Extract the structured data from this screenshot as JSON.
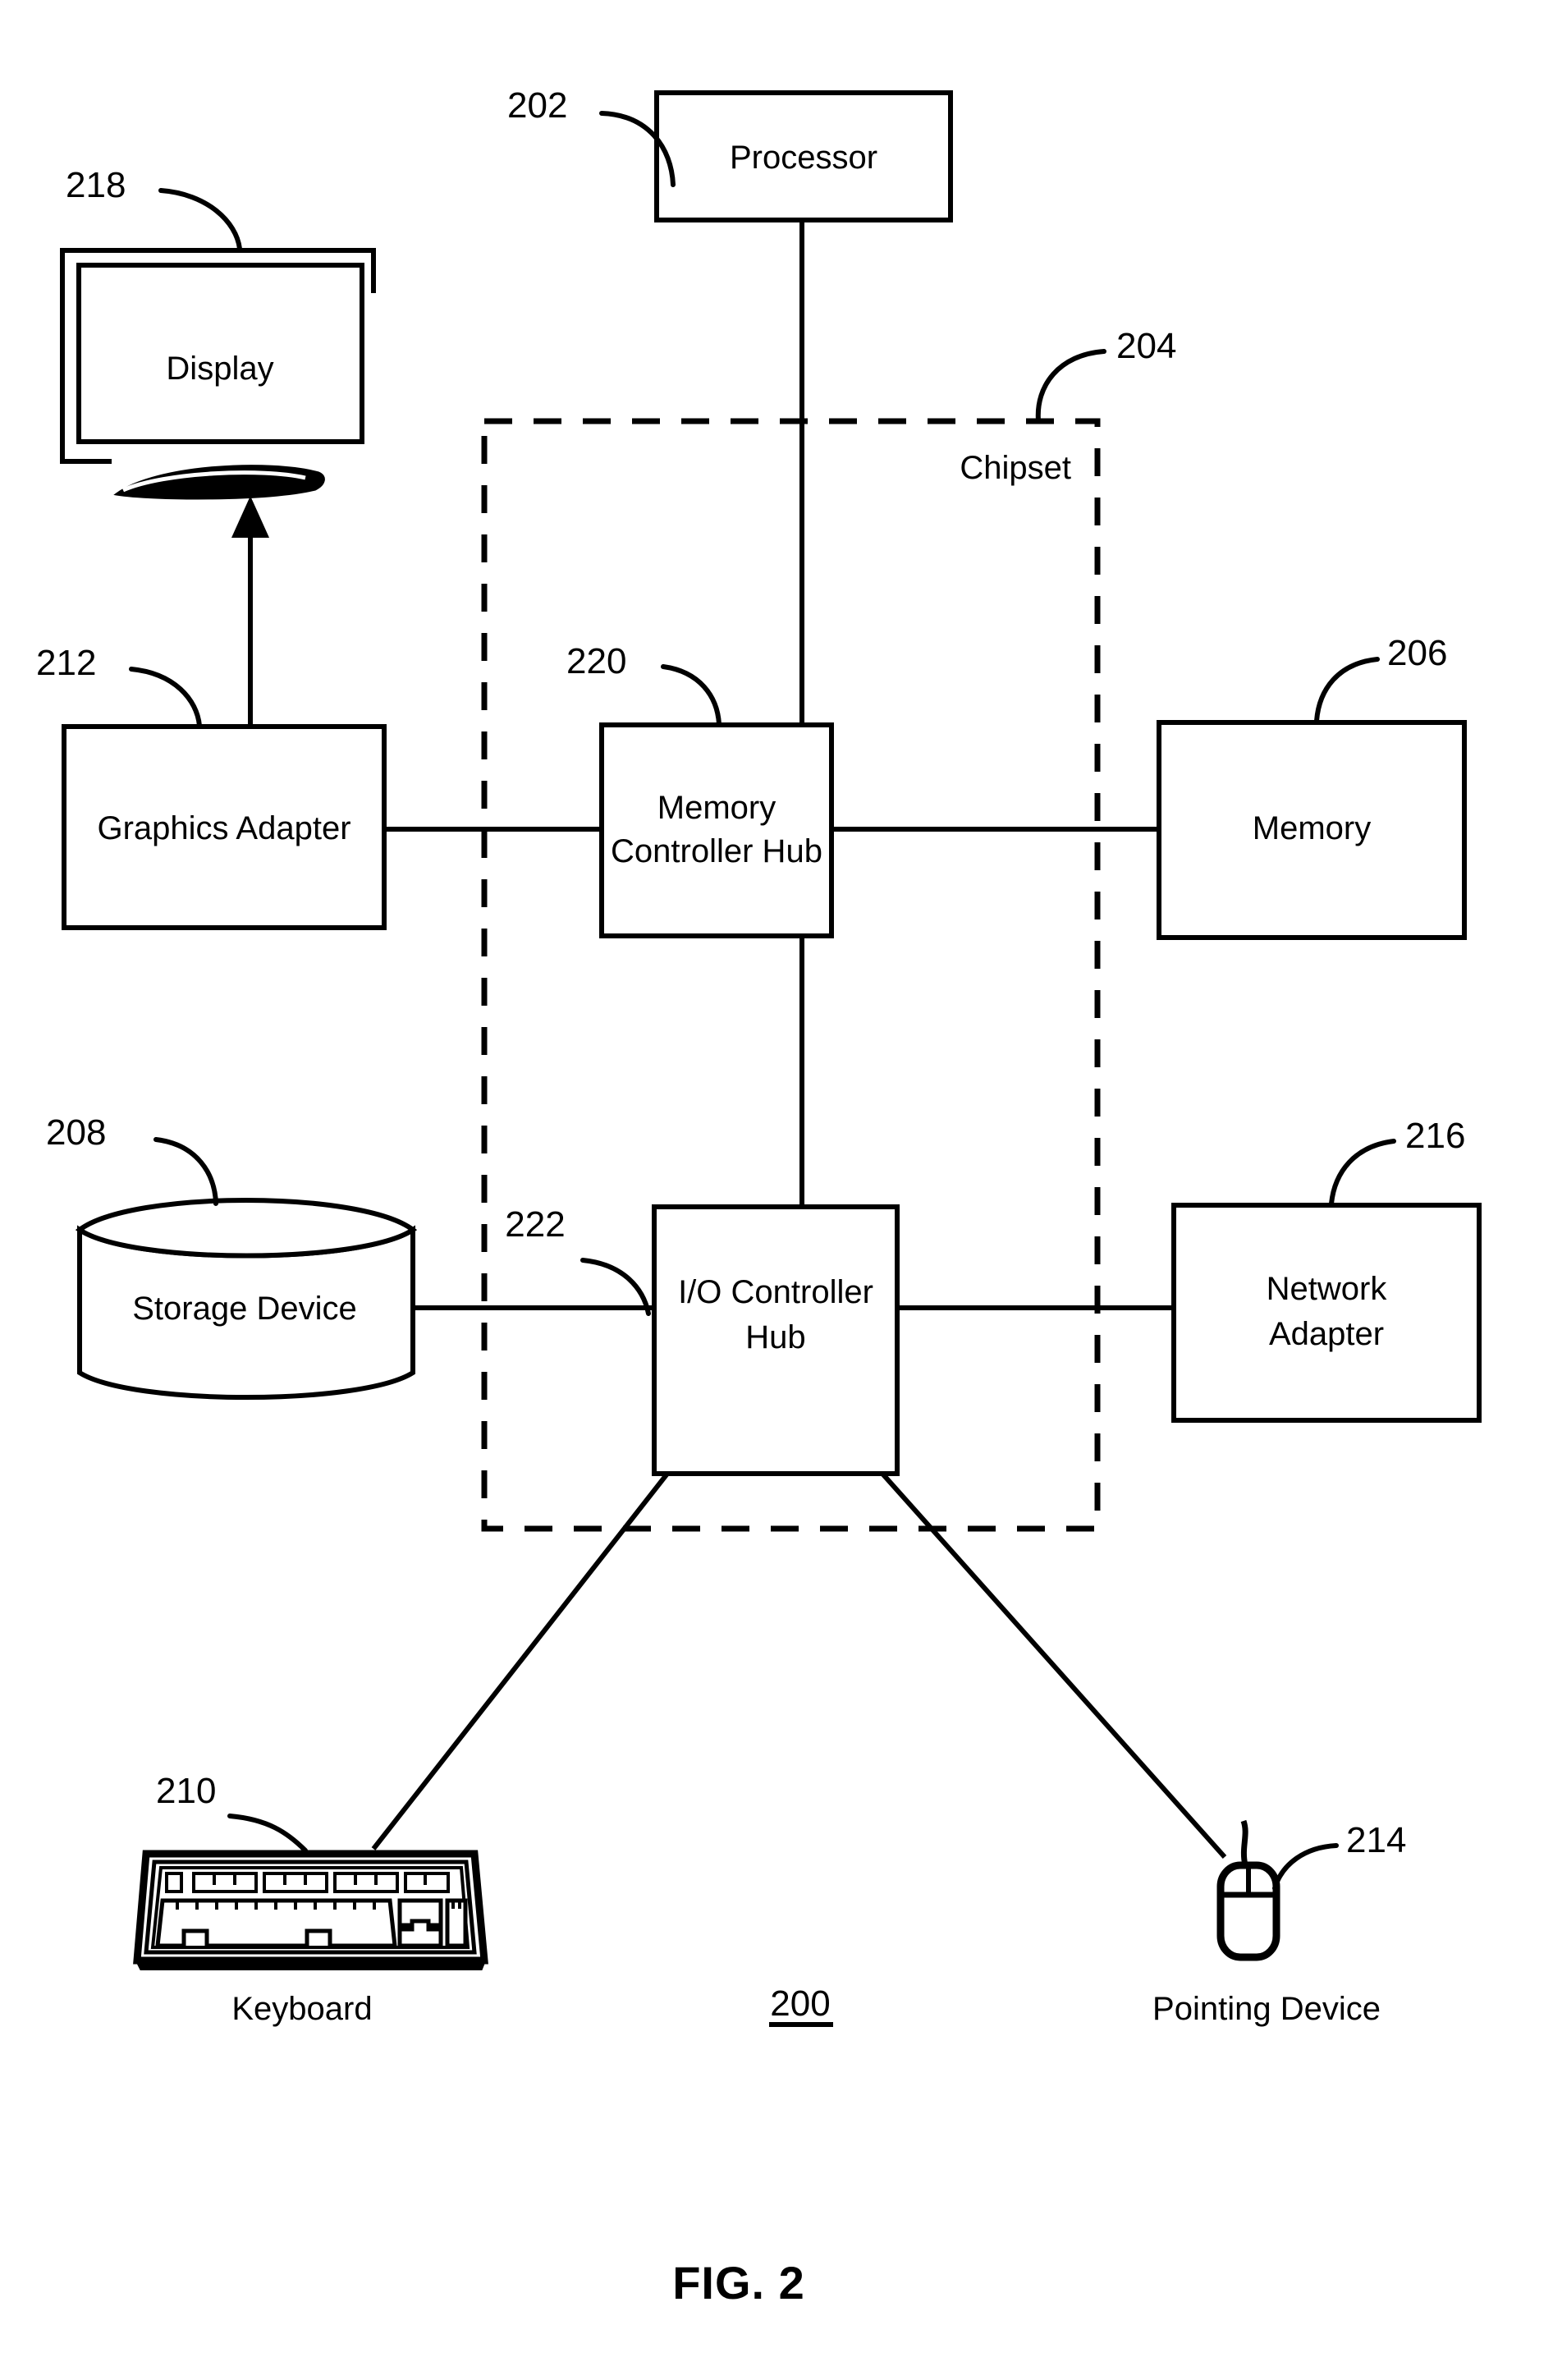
{
  "figure": {
    "caption": "FIG. 2",
    "system_ref": "200"
  },
  "blocks": {
    "processor": {
      "label": "Processor",
      "ref": "202"
    },
    "chipset": {
      "label": "Chipset",
      "ref": "204"
    },
    "memory": {
      "label": "Memory",
      "ref": "206"
    },
    "storage_device": {
      "label": "Storage Device",
      "ref": "208"
    },
    "keyboard": {
      "label": "Keyboard",
      "ref": "210"
    },
    "graphics_adapter": {
      "label": "Graphics Adapter",
      "ref": "212"
    },
    "pointing_device": {
      "label": "Pointing Device",
      "ref": "214"
    },
    "network_adapter": {
      "label": "Network\nAdapter",
      "line1": "Network",
      "line2": "Adapter",
      "ref": "216"
    },
    "display": {
      "label": "Display",
      "ref": "218"
    },
    "memory_controller_hub": {
      "line1": "Memory",
      "line2": "Controller Hub",
      "ref": "220"
    },
    "io_controller_hub": {
      "line1": "I/O Controller",
      "line2": "Hub",
      "ref": "222"
    }
  },
  "colors": {
    "ink": "#000000",
    "paper": "#ffffff"
  }
}
